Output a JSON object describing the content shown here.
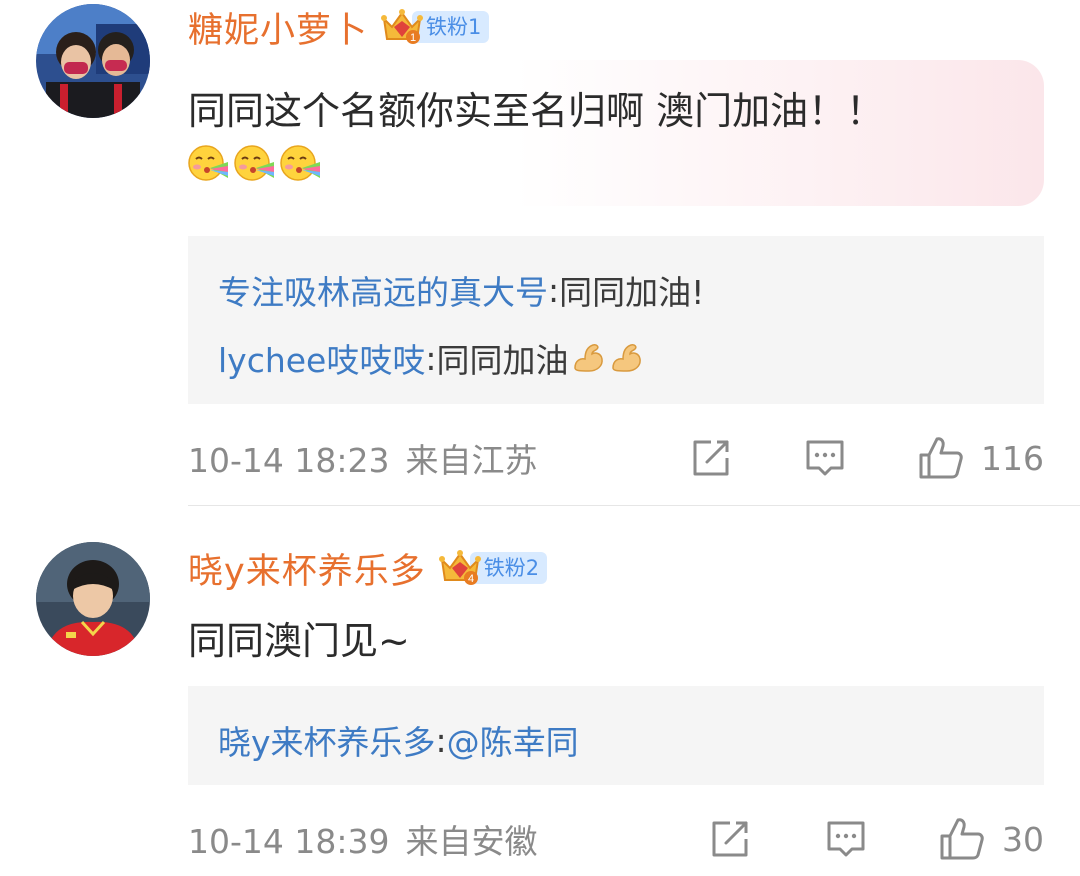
{
  "comments": [
    {
      "username": "糖妮小萝卜",
      "badge": {
        "level": "1",
        "label": "铁粉1"
      },
      "text": "同同这个名额你实至名归啊 澳门加油！！",
      "emojis": [
        "kiss-rainbow-emoji",
        "kiss-rainbow-emoji",
        "kiss-rainbow-emoji"
      ],
      "replies": [
        {
          "name": "专注吸林高远的真大号",
          "sep": ": ",
          "text": "同同加油!",
          "emojis": []
        },
        {
          "name": "lychee吱吱吱",
          "sep": ": ",
          "text": "同同加油",
          "emojis": [
            "muscle-emoji",
            "muscle-emoji"
          ]
        }
      ],
      "time": "10-14 18:23",
      "location": "来自江苏",
      "likes": "116"
    },
    {
      "username": "晓y来杯养乐多",
      "badge": {
        "level": "4",
        "label": "铁粉2"
      },
      "text": "同同澳门见~",
      "emojis": [],
      "replies": [
        {
          "name": "晓y来杯养乐多",
          "sep": ": ",
          "text": "@陈幸同",
          "emojis": []
        }
      ],
      "time": "10-14 18:39",
      "location": "来自安徽",
      "likes": "30"
    }
  ],
  "icons": {
    "repost": "share-edit-icon",
    "comment": "comment-icon",
    "like": "thumbs-up-icon"
  },
  "colors": {
    "username": "#e7702e",
    "reply_name": "#3e7bc4",
    "badge_bg": "#d8eaff",
    "badge_text": "#4a8ee6",
    "meta": "#8a8a8a"
  }
}
